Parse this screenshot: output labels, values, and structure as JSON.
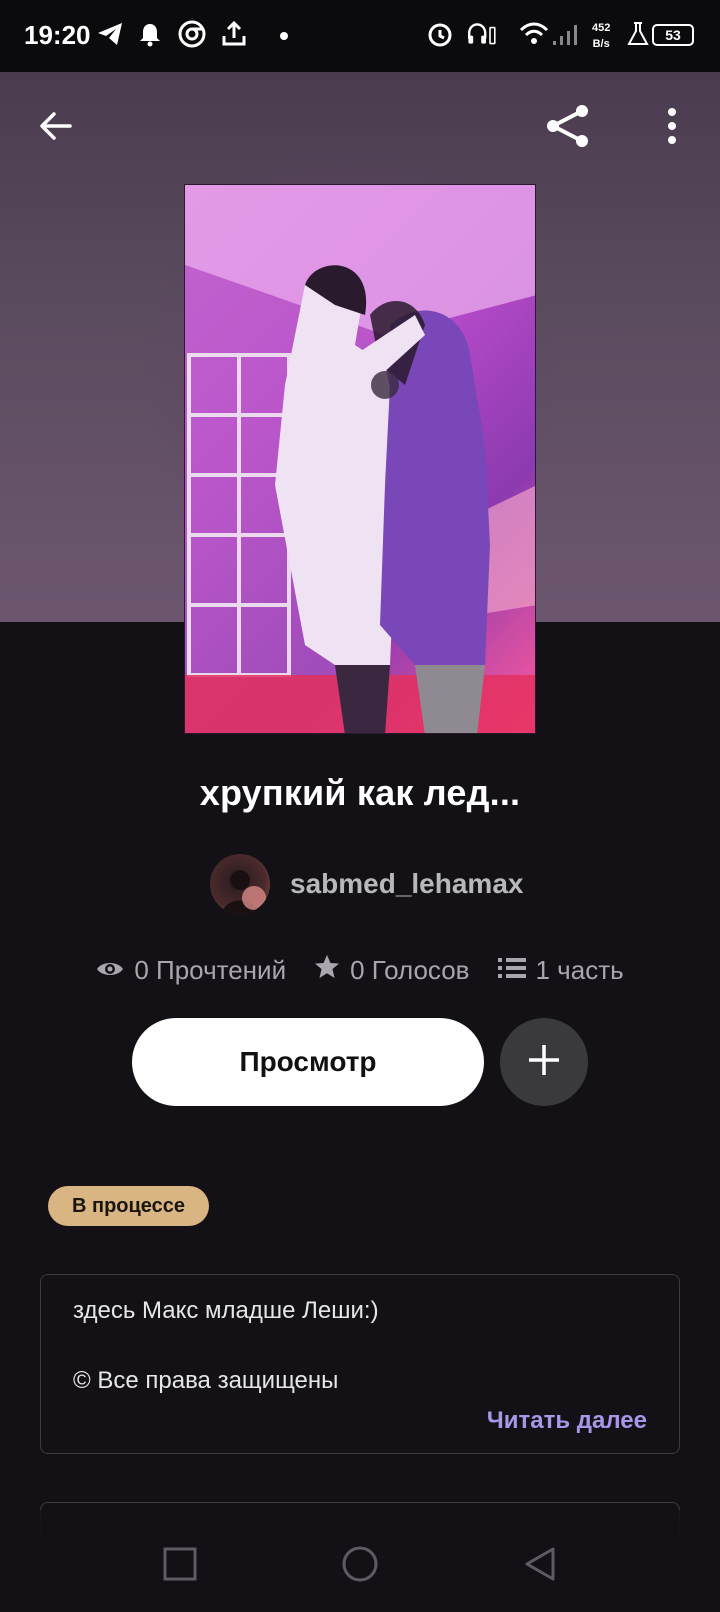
{
  "status_bar": {
    "time": "19:20",
    "speed_value": "452",
    "speed_unit": "B/s",
    "battery": "53",
    "icons": [
      "telegram-icon",
      "alarm-bell-icon",
      "chrome-icon",
      "upload-icon",
      "alarm-clock-icon",
      "headphones-icon",
      "wifi-icon",
      "signal-icon",
      "flask-icon"
    ]
  },
  "header": {
    "back_icon": "arrow-left-icon",
    "share_icon": "share-icon",
    "more_icon": "more-vertical-icon"
  },
  "story": {
    "title": "хрупкий как лед...",
    "author": "sabmed_lehamax",
    "reads": "0 Прочтений",
    "votes": "0 Голосов",
    "parts": "1 часть",
    "view_button": "Просмотр",
    "status_badge": "В процессе",
    "description_line1": "здесь Макс младше Леши:)",
    "description_line2": "© Все права защищены",
    "read_more": "Читать далее"
  },
  "colors": {
    "background": "#131115",
    "badge": "#d8b583",
    "read_more": "#a996e8",
    "stats_text": "#a9a7ad"
  },
  "nav": [
    "recents-square-icon",
    "home-circle-icon",
    "back-triangle-icon"
  ]
}
